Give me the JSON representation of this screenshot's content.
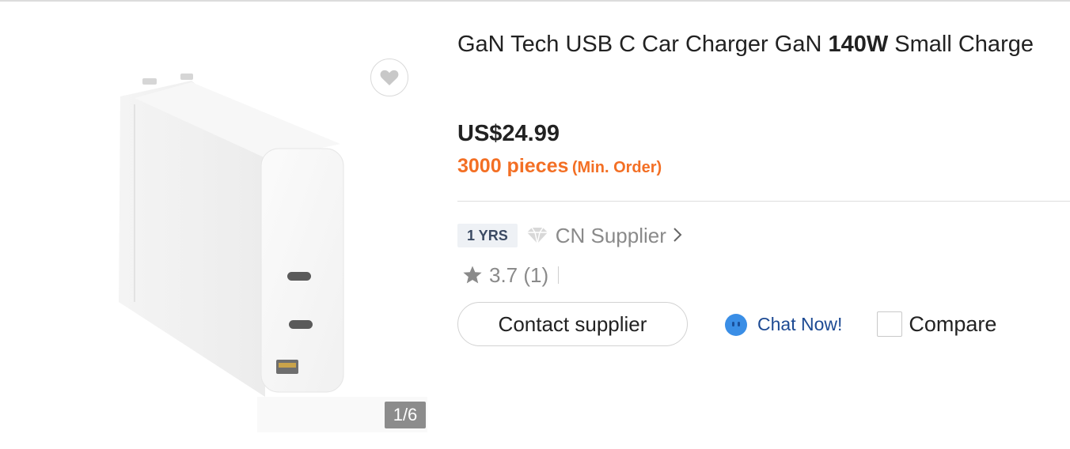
{
  "product": {
    "title_pre": "GaN Tech USB C Car Charger GaN ",
    "title_bold": "140W",
    "title_post": " Small Charge",
    "price": "US$24.99",
    "moq_qty": "3000 pieces",
    "moq_note": "(Min. Order)"
  },
  "gallery": {
    "counter": "1/6",
    "favorite_icon": "heart-icon"
  },
  "supplier": {
    "years": "1 YRS",
    "badge_icon": "diamond-icon",
    "label": "CN Supplier",
    "chevron_icon": "chevron-right-icon"
  },
  "rating": {
    "icon": "star-icon",
    "text": "3.7 (1)"
  },
  "actions": {
    "contact_label": "Contact supplier",
    "chat_label": "Chat Now!",
    "compare_label": "Compare"
  },
  "colors": {
    "accent_orange": "#f36f24",
    "chat_blue": "#1d4a93",
    "chat_icon_blue": "#3a8ee6"
  }
}
